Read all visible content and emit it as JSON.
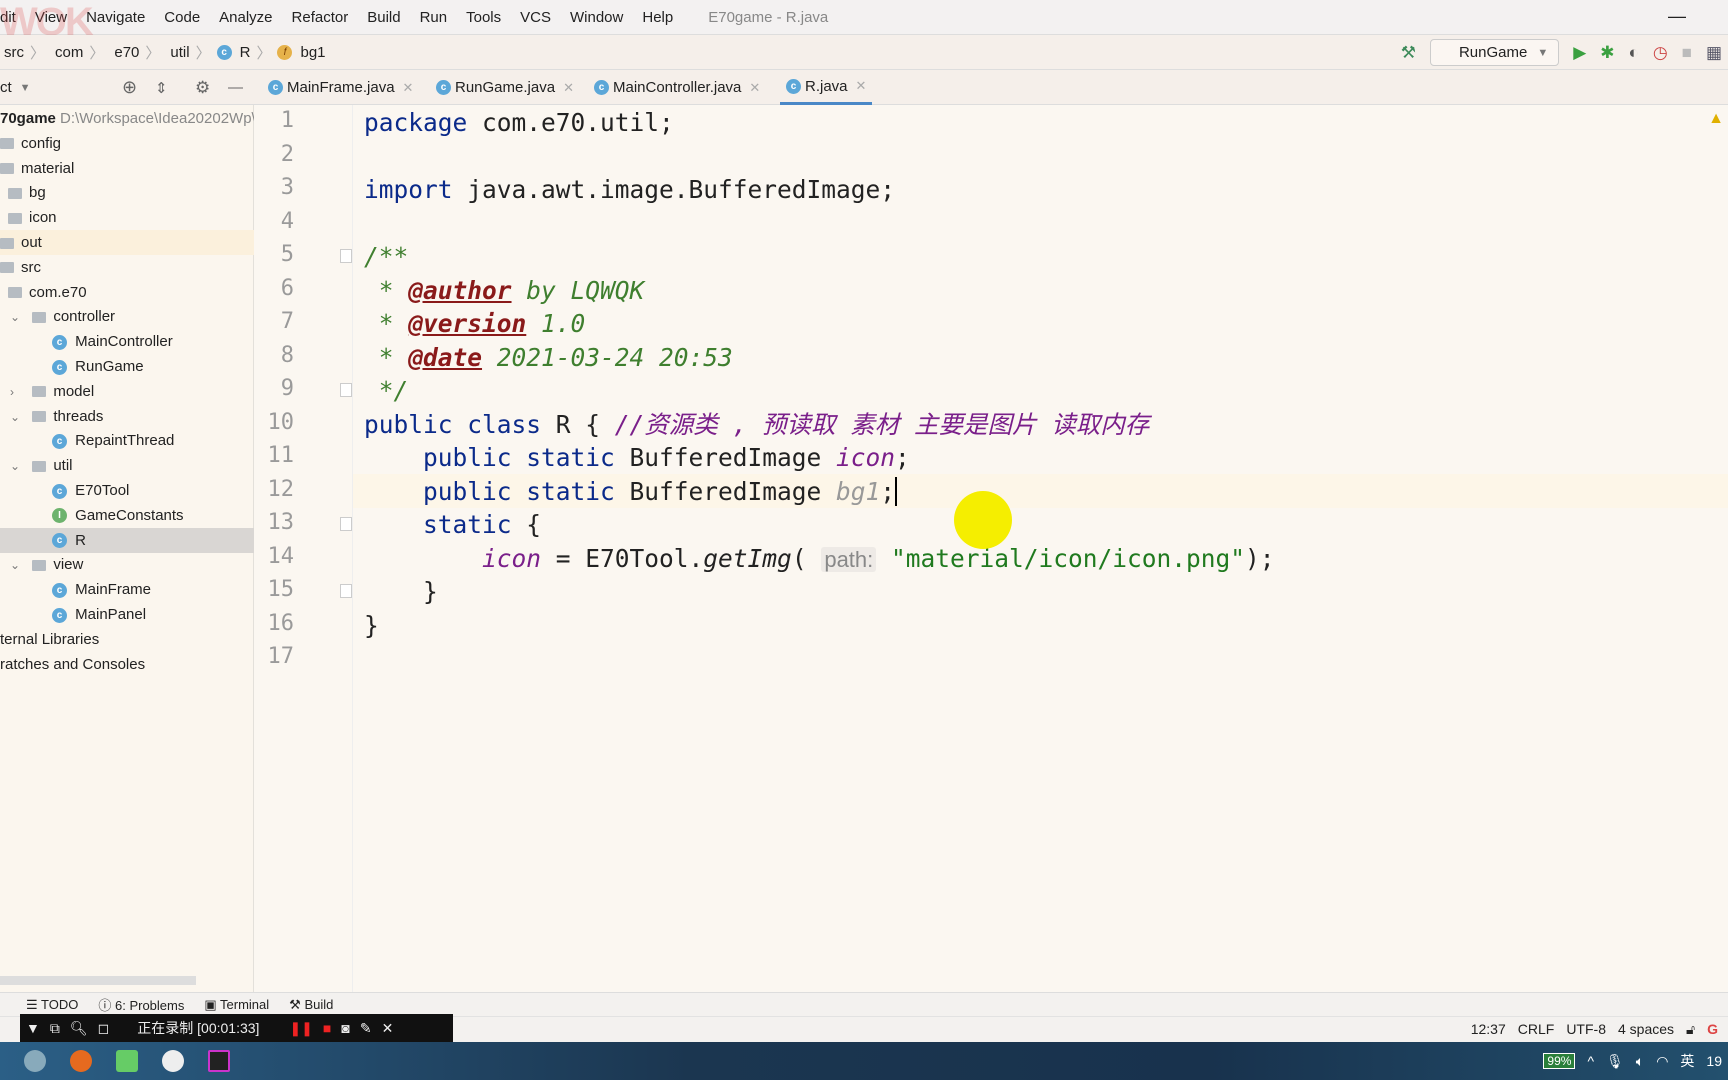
{
  "menubar": {
    "items": [
      "dit",
      "View",
      "Navigate",
      "Code",
      "Analyze",
      "Refactor",
      "Build",
      "Run",
      "Tools",
      "VCS",
      "Window",
      "Help"
    ],
    "title": "E70game - R.java"
  },
  "breadcrumb": [
    "src",
    "com",
    "e70",
    "util",
    "R",
    "bg1"
  ],
  "toolbar": {
    "run_config": "RunGame"
  },
  "project_panel": {
    "label": "ct"
  },
  "tabs": [
    {
      "label": "MainFrame.java"
    },
    {
      "label": "RunGame.java"
    },
    {
      "label": "MainController.java"
    },
    {
      "label": "R.java",
      "active": true
    }
  ],
  "tree": [
    {
      "label": "70game",
      "path": "D:\\Workspace\\Idea20202Wp\\",
      "depth": 0,
      "kind": "root"
    },
    {
      "label": "config",
      "depth": 0,
      "kind": "folder"
    },
    {
      "label": "material",
      "depth": 0,
      "kind": "folder"
    },
    {
      "label": "bg",
      "depth": 1,
      "kind": "folder"
    },
    {
      "label": "icon",
      "depth": 1,
      "kind": "folder"
    },
    {
      "label": "out",
      "depth": 0,
      "kind": "folder",
      "highlight": true
    },
    {
      "label": "src",
      "depth": 0,
      "kind": "folder"
    },
    {
      "label": "com.e70",
      "depth": 1,
      "kind": "folder"
    },
    {
      "label": "controller",
      "depth": 2,
      "kind": "folder",
      "chevron": "v"
    },
    {
      "label": "MainController",
      "depth": 3,
      "kind": "class"
    },
    {
      "label": "RunGame",
      "depth": 3,
      "kind": "class"
    },
    {
      "label": "model",
      "depth": 2,
      "kind": "folder",
      "chevron": ">"
    },
    {
      "label": "threads",
      "depth": 2,
      "kind": "folder",
      "chevron": "v"
    },
    {
      "label": "RepaintThread",
      "depth": 3,
      "kind": "class"
    },
    {
      "label": "util",
      "depth": 2,
      "kind": "folder",
      "chevron": "v"
    },
    {
      "label": "E70Tool",
      "depth": 3,
      "kind": "class"
    },
    {
      "label": "GameConstants",
      "depth": 3,
      "kind": "interface"
    },
    {
      "label": "R",
      "depth": 3,
      "kind": "class",
      "selected": true
    },
    {
      "label": "view",
      "depth": 2,
      "kind": "folder",
      "chevron": "v"
    },
    {
      "label": "MainFrame",
      "depth": 3,
      "kind": "class"
    },
    {
      "label": "MainPanel",
      "depth": 3,
      "kind": "class"
    },
    {
      "label": "ternal Libraries",
      "depth": 0,
      "kind": "text"
    },
    {
      "label": "ratches and Consoles",
      "depth": 0,
      "kind": "text"
    }
  ],
  "code": [
    [
      {
        "t": "package ",
        "c": "kw"
      },
      {
        "t": "com.e70.util;"
      }
    ],
    [],
    [
      {
        "t": "import ",
        "c": "kw"
      },
      {
        "t": "java.awt.image.BufferedImage;"
      }
    ],
    [],
    [
      {
        "t": "/**",
        "c": "cm"
      }
    ],
    [
      {
        "t": " * ",
        "c": "cm"
      },
      {
        "t": "@author",
        "c": "tag"
      },
      {
        "t": " by LQWQK",
        "c": "cm"
      }
    ],
    [
      {
        "t": " * ",
        "c": "cm"
      },
      {
        "t": "@version",
        "c": "tag"
      },
      {
        "t": " 1.0",
        "c": "cm"
      }
    ],
    [
      {
        "t": " * ",
        "c": "cm"
      },
      {
        "t": "@date",
        "c": "tag"
      },
      {
        "t": " 2021-03-24 20:53",
        "c": "cm"
      }
    ],
    [
      {
        "t": " */",
        "c": "cm"
      }
    ],
    [
      {
        "t": "public class ",
        "c": "kw"
      },
      {
        "t": "R { "
      },
      {
        "t": "//资源类 , 预读取 素材 主要是图片 读取内存",
        "c": "cmz"
      }
    ],
    [
      {
        "t": "    public static ",
        "c": "kw"
      },
      {
        "t": "BufferedImage "
      },
      {
        "t": "icon",
        "c": "fld"
      },
      {
        "t": ";"
      }
    ],
    [
      {
        "t": "    public static ",
        "c": "kw"
      },
      {
        "t": "BufferedImage "
      },
      {
        "t": "bg1",
        "c": "fldg"
      },
      {
        "t": ";",
        "c": "caret"
      }
    ],
    [
      {
        "t": "    static ",
        "c": "kw"
      },
      {
        "t": "{"
      }
    ],
    [
      {
        "t": "        "
      },
      {
        "t": "icon",
        "c": "fld"
      },
      {
        "t": " = E70Tool."
      },
      {
        "t": "getImg",
        "c": "mth"
      },
      {
        "t": "( "
      },
      {
        "t": "path:",
        "c": "hint"
      },
      {
        "t": " "
      },
      {
        "t": "\"material/icon/icon.png\"",
        "c": "st"
      },
      {
        "t": ");"
      }
    ],
    [
      {
        "t": "    }"
      }
    ],
    [
      {
        "t": "}"
      }
    ],
    []
  ],
  "toolwindows": [
    "TODO",
    "6: Problems",
    "Terminal",
    "Build"
  ],
  "recorder": {
    "status": "正在录制 [00:01:33]"
  },
  "statusbar": {
    "position": "12:37",
    "line_sep": "CRLF",
    "encoding": "UTF-8",
    "indent": "4 spaces"
  },
  "tray": {
    "battery": "99%",
    "ime": "英",
    "clock": "19"
  }
}
